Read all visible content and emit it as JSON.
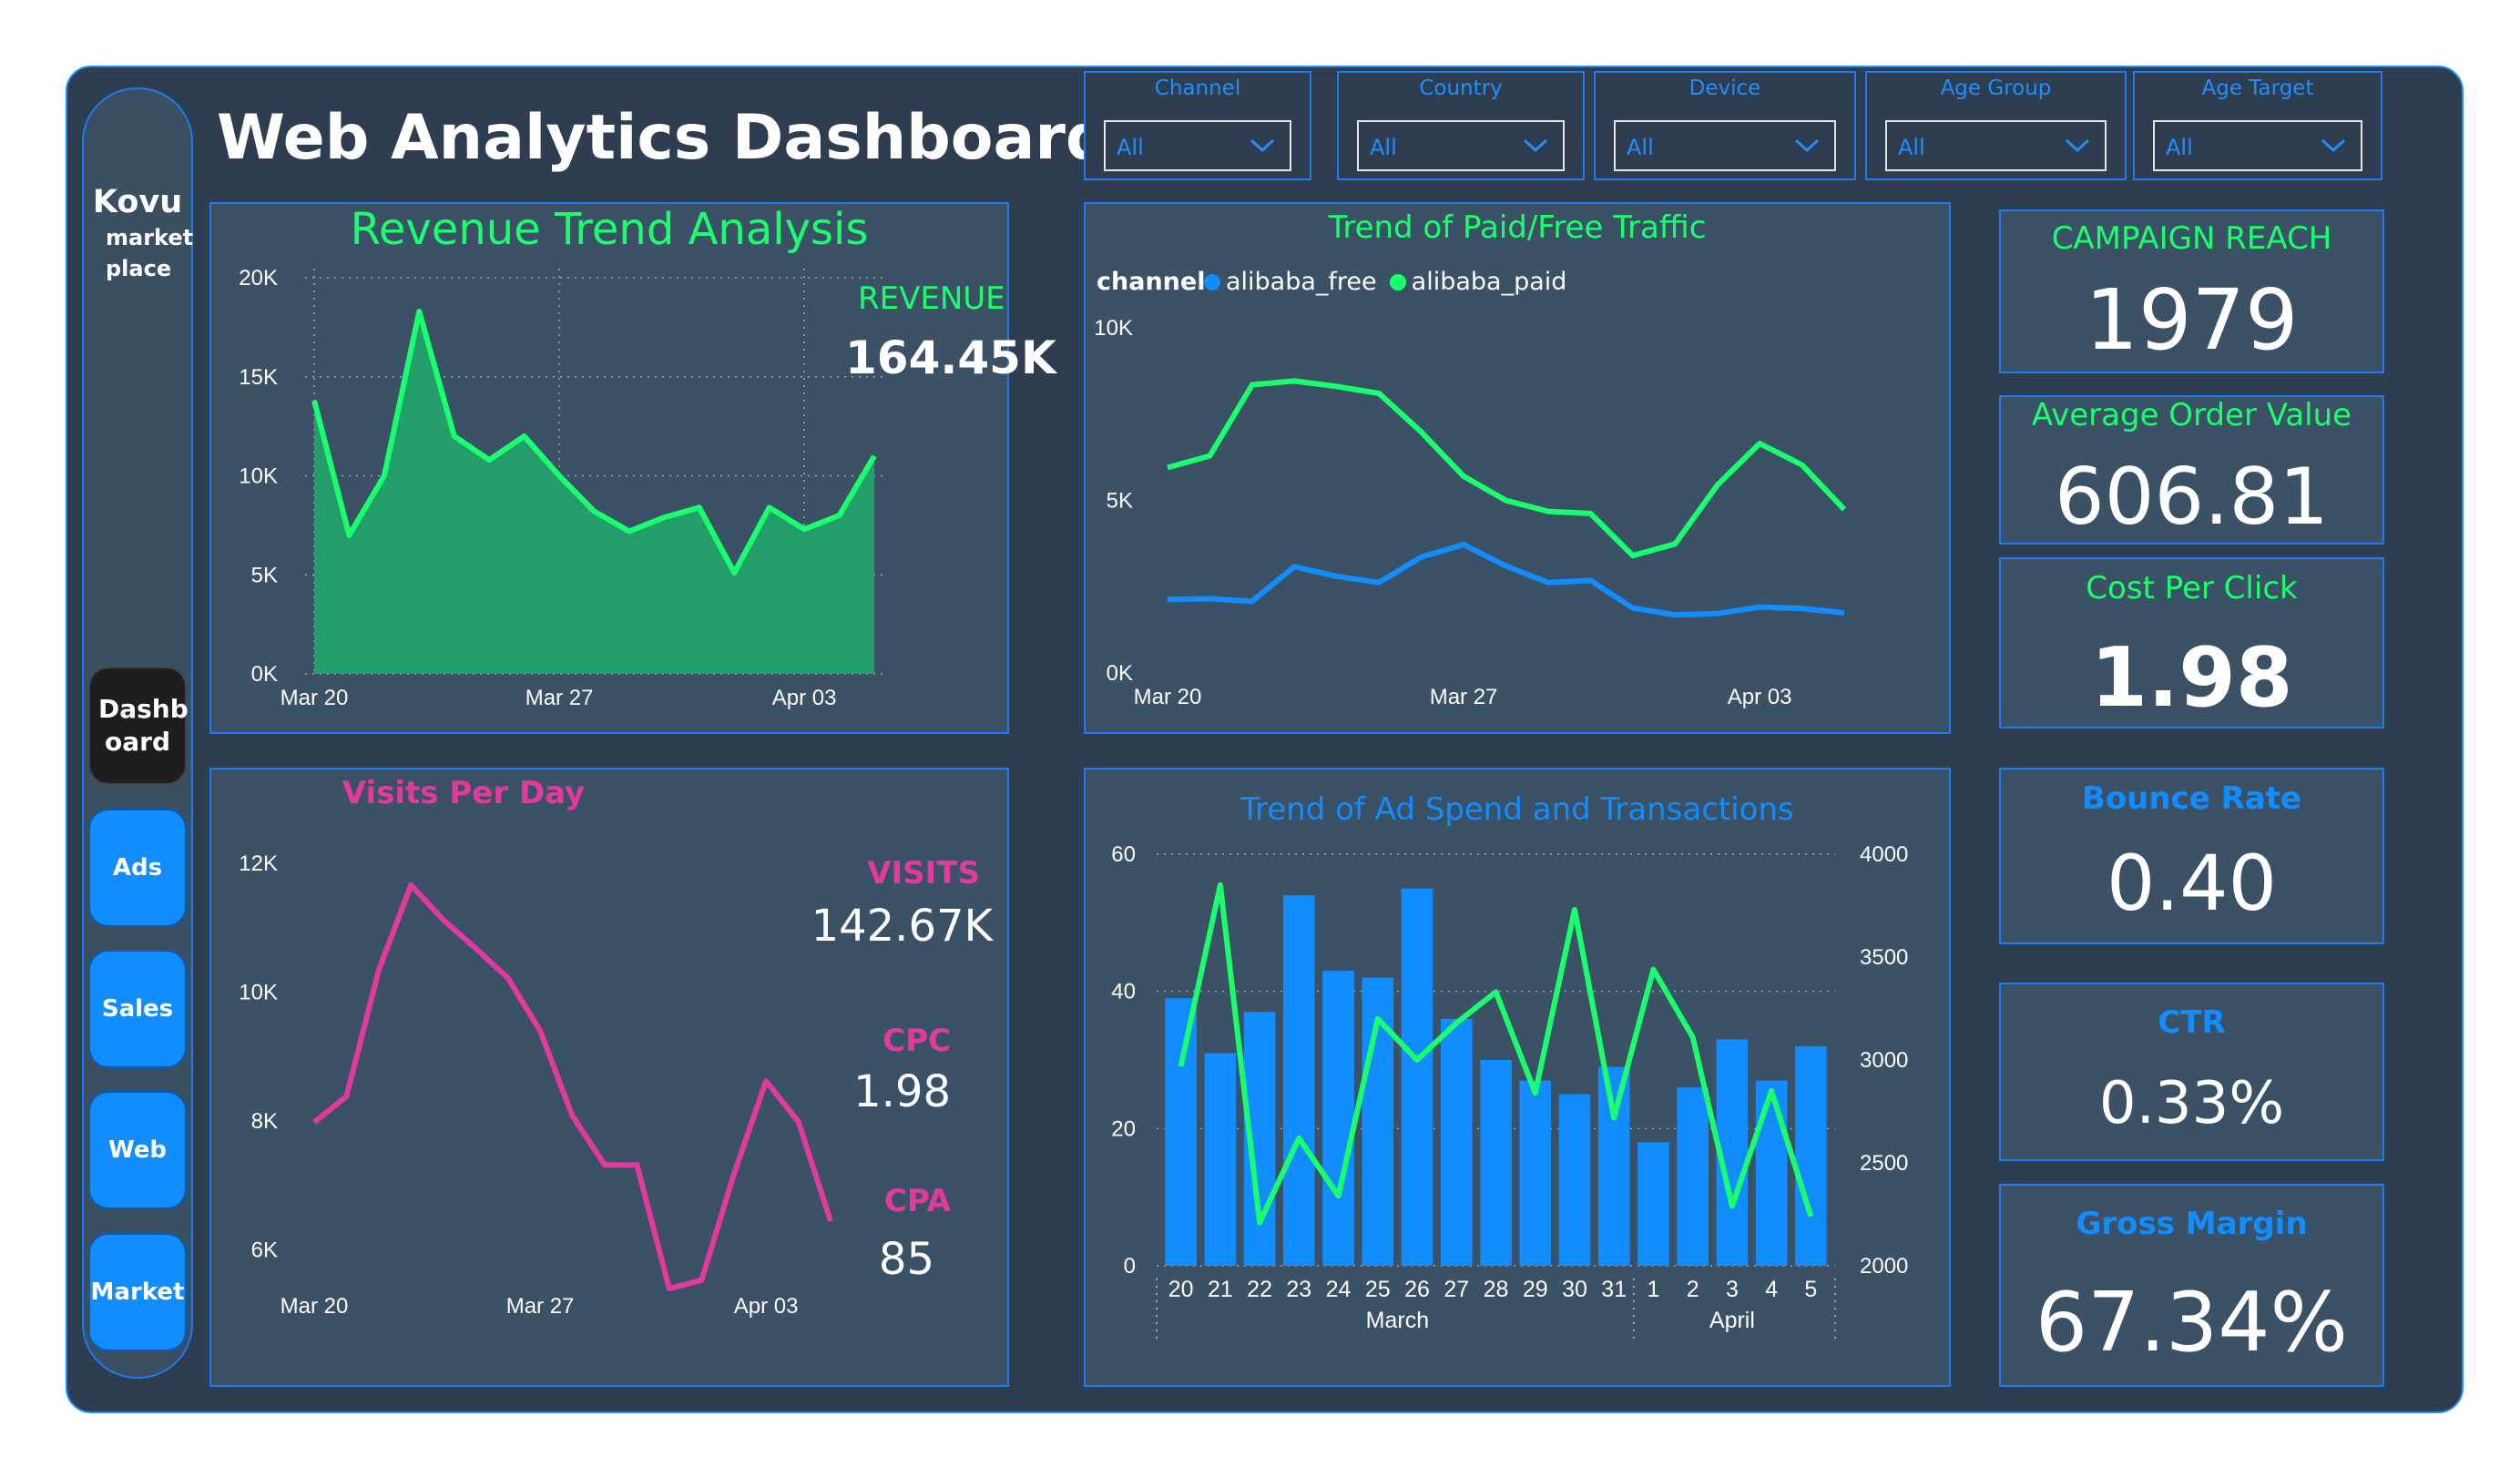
{
  "app": {
    "title": "Web Analytics Dashboard",
    "brand_name": "Kovu",
    "brand_sub": "market place"
  },
  "nav": {
    "items": [
      {
        "label": "Dashb oard"
      },
      {
        "label": "Ads"
      },
      {
        "label": "Sales"
      },
      {
        "label": "Web"
      },
      {
        "label": "Market"
      }
    ]
  },
  "filters": [
    {
      "label": "Channel",
      "value": "All"
    },
    {
      "label": "Country",
      "value": "All"
    },
    {
      "label": "Device",
      "value": "All"
    },
    {
      "label": "Age Group",
      "value": "All"
    },
    {
      "label": "Age Target",
      "value": "All"
    }
  ],
  "colors": {
    "green": "#1aff6e",
    "blue": "#118dff",
    "pink": "#e3399f",
    "panel": "#3b5166",
    "bg": "#2e3e50"
  },
  "revenue_panel": {
    "title": "Revenue Trend Analysis",
    "kpi_label": "REVENUE",
    "kpi_value": "164.45K"
  },
  "visits_panel": {
    "title": "Visits Per Day",
    "kpis": [
      {
        "label": "VISITS",
        "value": "142.67K"
      },
      {
        "label": "CPC",
        "value": "1.98"
      },
      {
        "label": "CPA",
        "value": "85"
      }
    ]
  },
  "traffic_panel": {
    "title": "Trend of Paid/Free Traffic",
    "legend_title": "channel"
  },
  "adspend_panel": {
    "title": "Trend of Ad Spend and Transactions",
    "month_labels": [
      "March",
      "April"
    ]
  },
  "kpis": [
    {
      "label": "CAMPAIGN REACH",
      "value": "1979"
    },
    {
      "label": "Average Order Value",
      "value": "606.81"
    },
    {
      "label": "Cost Per Click",
      "value": "1.98"
    },
    {
      "label": "Bounce Rate",
      "value": "0.40"
    },
    {
      "label": "CTR",
      "value": "0.33%"
    },
    {
      "label": "Gross Margin",
      "value": "67.34%"
    }
  ],
  "chart_data": [
    {
      "id": "revenue",
      "type": "area",
      "title": "Revenue Trend Analysis",
      "x": [
        "Mar 20",
        "Mar 21",
        "Mar 22",
        "Mar 23",
        "Mar 24",
        "Mar 25",
        "Mar 26",
        "Mar 27",
        "Mar 28",
        "Mar 29",
        "Mar 30",
        "Mar 31",
        "Apr 01",
        "Apr 02",
        "Apr 03",
        "Apr 04",
        "Apr 05"
      ],
      "x_tick_labels": [
        "Mar 20",
        "Mar 27",
        "Apr 03"
      ],
      "values": [
        13800,
        7000,
        10000,
        18300,
        12000,
        10800,
        12000,
        10000,
        8200,
        7200,
        7900,
        8400,
        5100,
        8400,
        7300,
        8000,
        11000
      ],
      "ylim": [
        0,
        20000
      ],
      "y_ticks": [
        "0K",
        "5K",
        "10K",
        "15K",
        "20K"
      ],
      "grid": true
    },
    {
      "id": "visits",
      "type": "line",
      "title": "Visits Per Day",
      "x": [
        "Mar 20",
        "Mar 21",
        "Mar 22",
        "Mar 23",
        "Mar 24",
        "Mar 25",
        "Mar 26",
        "Mar 27",
        "Mar 28",
        "Mar 29",
        "Mar 30",
        "Mar 31",
        "Apr 01",
        "Apr 02",
        "Apr 03",
        "Apr 04",
        "Apr 05"
      ],
      "x_tick_labels": [
        "Mar 20",
        "Mar 27",
        "Apr 03"
      ],
      "values": [
        7980,
        8380,
        10340,
        11660,
        11120,
        10680,
        10220,
        9400,
        8080,
        7320,
        7320,
        5400,
        5530,
        7170,
        8620,
        7990,
        6450
      ],
      "ylim": [
        5500,
        12450
      ],
      "y_ticks": [
        "6K",
        "8K",
        "10K",
        "12K"
      ],
      "grid": false
    },
    {
      "id": "traffic",
      "type": "line",
      "title": "Trend of Paid/Free Traffic",
      "x": [
        "Mar 20",
        "Mar 21",
        "Mar 22",
        "Mar 23",
        "Mar 24",
        "Mar 25",
        "Mar 26",
        "Mar 27",
        "Mar 28",
        "Mar 29",
        "Mar 30",
        "Mar 31",
        "Apr 01",
        "Apr 02",
        "Apr 03",
        "Apr 04",
        "Apr 05"
      ],
      "x_tick_labels": [
        "Mar 20",
        "Mar 27",
        "Apr 03"
      ],
      "ylim": [
        0,
        10000
      ],
      "y_ticks": [
        "0K",
        "5K",
        "10K"
      ],
      "series": [
        {
          "name": "alibaba_free",
          "values": [
            2130,
            2150,
            2080,
            3080,
            2800,
            2620,
            3360,
            3720,
            3100,
            2620,
            2680,
            1880,
            1680,
            1720,
            1910,
            1870,
            1740
          ]
        },
        {
          "name": "alibaba_paid",
          "values": [
            5950,
            6290,
            8350,
            8460,
            8300,
            8100,
            6980,
            5700,
            5000,
            4680,
            4620,
            3400,
            3740,
            5440,
            6650,
            6030,
            4740
          ]
        }
      ]
    },
    {
      "id": "adspend",
      "type": "bar",
      "title": "Trend of Ad Spend and Transactions",
      "categories": [
        "20",
        "21",
        "22",
        "23",
        "24",
        "25",
        "26",
        "27",
        "28",
        "29",
        "30",
        "31",
        "1",
        "2",
        "3",
        "4",
        "5"
      ],
      "ylim": [
        0,
        60
      ],
      "y_ticks": [
        "0",
        "20",
        "40",
        "60"
      ],
      "y2lim": [
        2000,
        4000
      ],
      "y2_ticks": [
        "2000",
        "2500",
        "3000",
        "3500",
        "4000"
      ],
      "series": [
        {
          "values": [
            39,
            31,
            37,
            54,
            43,
            42,
            55,
            36,
            30,
            27,
            25,
            29,
            18,
            26,
            33,
            27,
            32
          ],
          "axis": "left"
        },
        {
          "values": [
            2970,
            3850,
            2210,
            2620,
            2340,
            3200,
            3000,
            3180,
            3330,
            2840,
            3730,
            2720,
            3440,
            3110,
            2290,
            2850,
            2240
          ],
          "axis": "right"
        }
      ],
      "grid": true
    }
  ]
}
